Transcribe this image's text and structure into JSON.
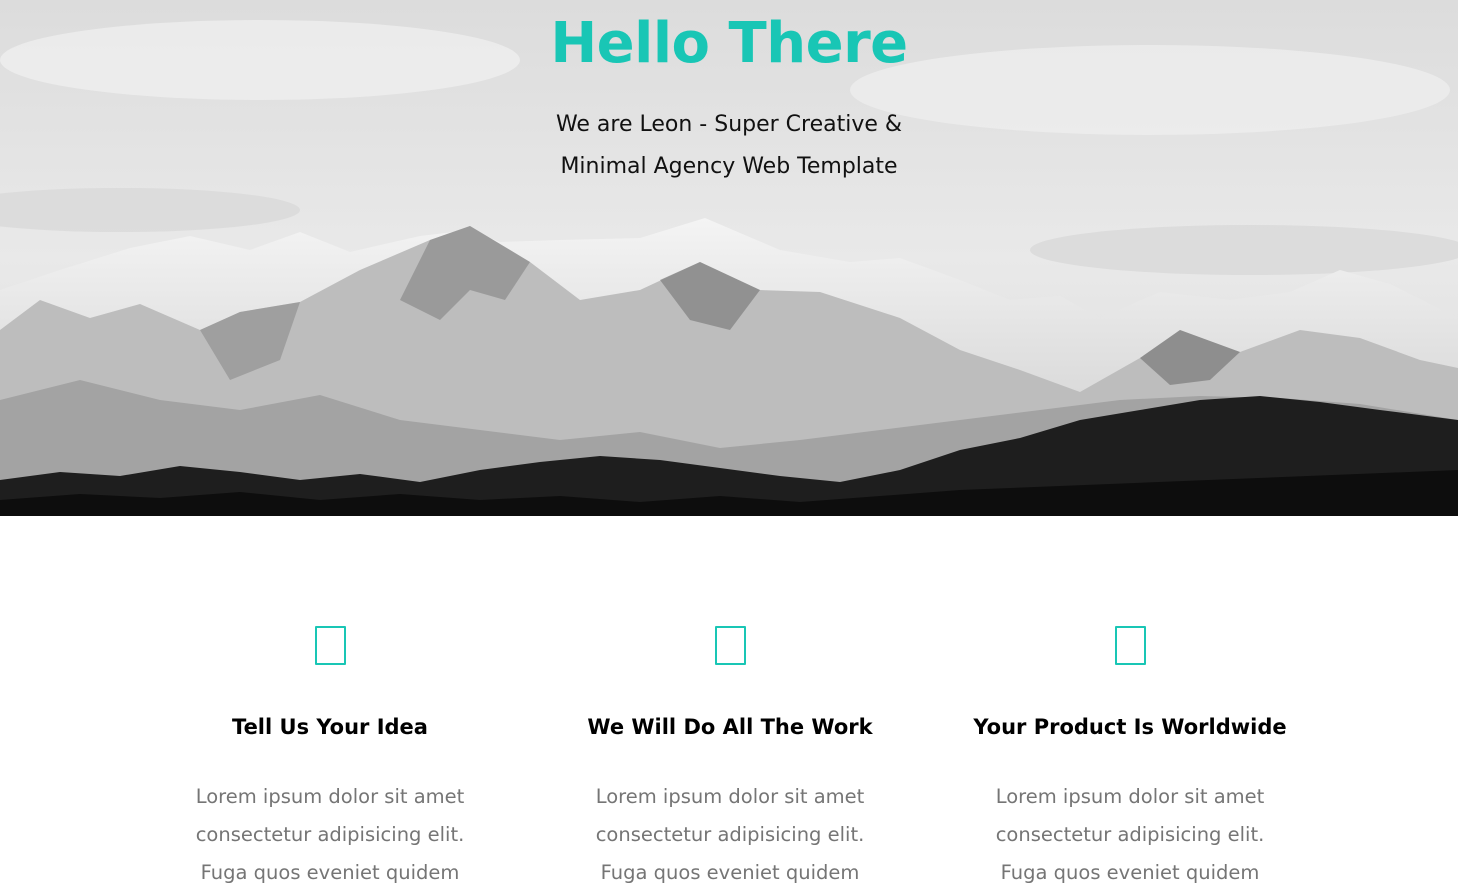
{
  "hero": {
    "title": "Hello There",
    "subtitle_line1": "We are Leon - Super Creative &",
    "subtitle_line2": "Minimal Agency Web Template",
    "accent_color": "#19c6b5",
    "background_image": "black-and-white snowy mountain range under cloudy sky"
  },
  "features": [
    {
      "icon": "outline-box-icon",
      "title": "Tell Us Your Idea",
      "line1": "Lorem ipsum dolor sit amet",
      "line2": "consectetur adipisicing elit.",
      "line3": "Fuga quos eveniet quidem"
    },
    {
      "icon": "outline-box-icon",
      "title": "We Will Do All The Work",
      "line1": "Lorem ipsum dolor sit amet",
      "line2": "consectetur adipisicing elit.",
      "line3": "Fuga quos eveniet quidem"
    },
    {
      "icon": "outline-box-icon",
      "title": "Your Product Is Worldwide",
      "line1": "Lorem ipsum dolor sit amet",
      "line2": "consectetur adipisicing elit.",
      "line3": "Fuga quos eveniet quidem"
    }
  ]
}
